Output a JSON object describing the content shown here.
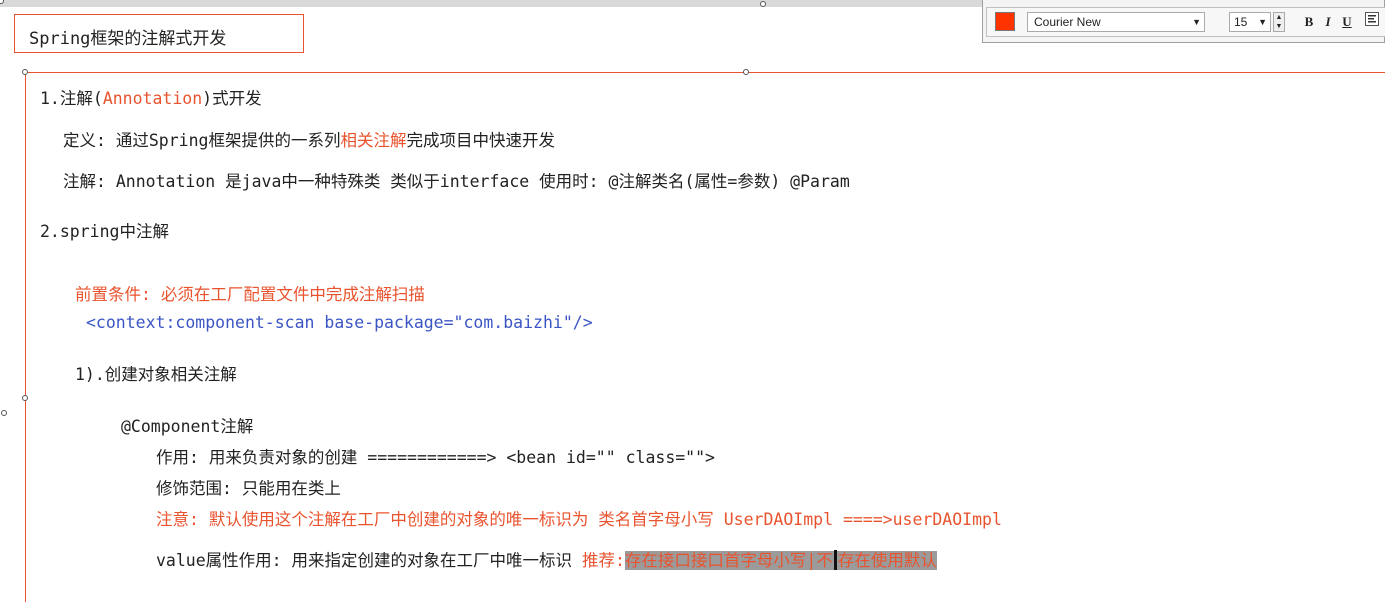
{
  "title": "Spring框架的注解式开发",
  "toolbar": {
    "text_color": "#ff3300",
    "font_name": "Courier New",
    "font_size": "15",
    "bold_label": "B",
    "italic_label": "I",
    "underline_label": "U"
  },
  "content": {
    "s1_heading_pre": "1.注解(",
    "s1_heading_red": "Annotation",
    "s1_heading_post": ")式开发",
    "definition_pre": "定义: 通过Spring框架提供的一系列",
    "definition_red": "相关注解",
    "definition_post": "完成项目中快速开发",
    "annotation_line": "注解: Annotation 是java中一种特殊类 类似于interface 使用时: @注解类名(属性=参数) @Param",
    "s2_heading": "2.spring中注解",
    "precondition": "前置条件: 必须在工厂配置文件中完成注解扫描",
    "context_scan": "<context:component-scan base-package=\"com.baizhi\"/>",
    "sub1_heading": "1).创建对象相关注解",
    "component_heading": "@Component注解",
    "purpose": "作用: 用来负责对象的创建      ============>   <bean id=\"\" class=\"\">",
    "scope": "修饰范围: 只能用在类上",
    "note": "注意: 默认使用这个注解在工厂中创建的对象的唯一标识为 类名首字母小写  UserDAOImpl  ====>userDAOImpl",
    "value_pre": "value属性作用: 用来指定创建的对象在工厂中唯一标识 ",
    "value_red": "推荐:",
    "value_sel_1": "存在接口接口首字母小写|不",
    "value_sel_2": "存在使用默认"
  }
}
